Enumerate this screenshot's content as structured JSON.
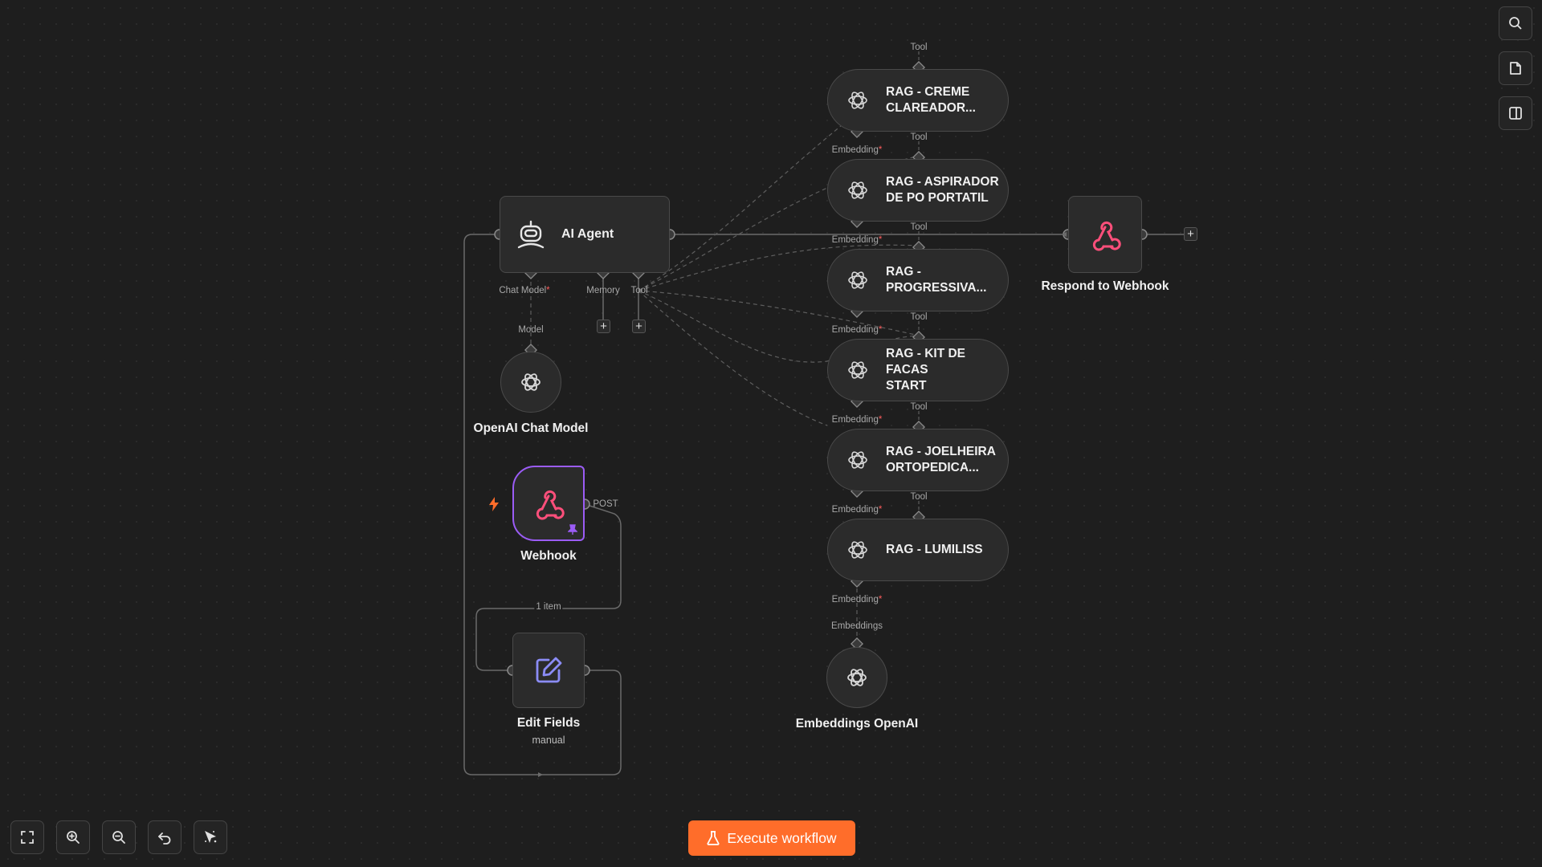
{
  "canvas": {
    "nodes": {
      "ai_agent": {
        "title": "AI Agent",
        "ports": {
          "chat_model": "Chat Model",
          "memory": "Memory",
          "tool": "Tool",
          "required_mark": "*"
        }
      },
      "openai_chat_model": {
        "title": "OpenAI Chat Model",
        "port_label": "Model"
      },
      "webhook": {
        "title": "Webhook",
        "method": "POST"
      },
      "edit_fields": {
        "title": "Edit Fields",
        "subtitle": "manual"
      },
      "respond_to_webhook": {
        "title": "Respond to Webhook"
      },
      "embeddings_openai": {
        "title": "Embeddings OpenAI",
        "port_label": "Embeddings"
      },
      "rag_tools": [
        {
          "title_line1": "RAG - CREME",
          "title_line2": "CLAREADOR..."
        },
        {
          "title_line1": "RAG - ASPIRADOR",
          "title_line2": "DE PO PORTATIL"
        },
        {
          "title_line1": "RAG -",
          "title_line2": "PROGRESSIVA..."
        },
        {
          "title_line1": "RAG - KIT DE FACAS",
          "title_line2": "START"
        },
        {
          "title_line1": "RAG - JOELHEIRA",
          "title_line2": "ORTOPEDICA..."
        },
        {
          "title_line1": "RAG - LUMILISS",
          "title_line2": ""
        }
      ],
      "rag_port_labels": {
        "tool": "Tool",
        "embedding": "Embedding",
        "required_mark": "*"
      }
    },
    "connection_label": "1 item"
  },
  "toolbar": {
    "execute_label": "Execute workflow",
    "controls": [
      "fit-view-icon",
      "zoom-in-icon",
      "zoom-out-icon",
      "undo-icon",
      "tidy-up-icon"
    ]
  },
  "right_panel": {
    "buttons": [
      "search-icon",
      "sticky-note-icon",
      "panel-toggle-icon"
    ]
  },
  "colors": {
    "accent": "#ff6d2a",
    "webhook_pink": "#ff4f7b",
    "pinned_purple": "#9b5cf6",
    "edit_purple": "#8b8cf6",
    "required": "#ff5c5c"
  }
}
